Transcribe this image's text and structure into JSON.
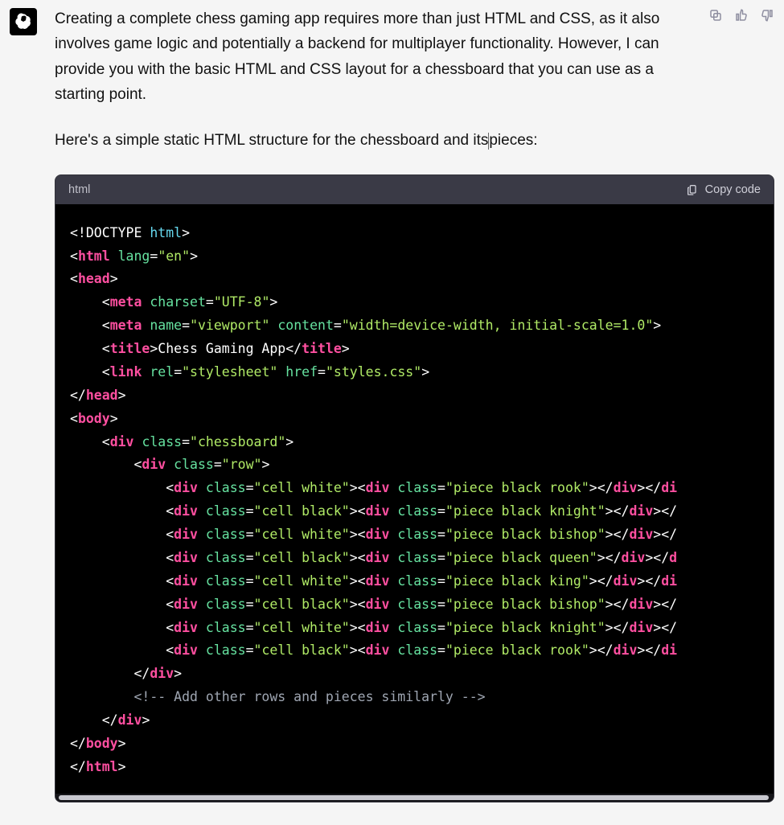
{
  "message": {
    "paragraph1": "Creating a complete chess gaming app requires more than just HTML and CSS, as it also involves game logic and potentially a backend for multiplayer functionality. However, I can provide you with the basic HTML and CSS layout for a chessboard that you can use as a starting point.",
    "paragraph2a": "Here's a simple static HTML structure for the chessboard and its",
    "paragraph2b": "pieces:"
  },
  "code_block": {
    "language": "html",
    "copy_label": "Copy code",
    "lines": [
      {
        "type": "plain",
        "text": "<!DOCTYPE ",
        "after": "html",
        "after_class": "c-keyword",
        "close": ">"
      },
      {
        "type": "tag_open",
        "indent": 0,
        "tag": "html",
        "attrs": [
          {
            "name": "lang",
            "value": "\"en\""
          }
        ]
      },
      {
        "type": "tag_open",
        "indent": 0,
        "tag": "head"
      },
      {
        "type": "tag_open",
        "indent": 1,
        "tag": "meta",
        "attrs": [
          {
            "name": "charset",
            "value": "\"UTF-8\""
          }
        ]
      },
      {
        "type": "tag_open",
        "indent": 1,
        "tag": "meta",
        "attrs": [
          {
            "name": "name",
            "value": "\"viewport\""
          },
          {
            "name": "content",
            "value": "\"width=device-width, initial-scale=1.0\""
          }
        ]
      },
      {
        "type": "tag_with_text",
        "indent": 1,
        "open": "title",
        "text": "Chess Gaming App",
        "close": "title"
      },
      {
        "type": "tag_open",
        "indent": 1,
        "tag": "link",
        "attrs": [
          {
            "name": "rel",
            "value": "\"stylesheet\""
          },
          {
            "name": "href",
            "value": "\"styles.css\""
          }
        ]
      },
      {
        "type": "tag_close",
        "indent": 0,
        "tag": "head"
      },
      {
        "type": "tag_open",
        "indent": 0,
        "tag": "body"
      },
      {
        "type": "tag_open",
        "indent": 1,
        "tag": "div",
        "attrs": [
          {
            "name": "class",
            "value": "\"chessboard\""
          }
        ]
      },
      {
        "type": "tag_open",
        "indent": 2,
        "tag": "div",
        "attrs": [
          {
            "name": "class",
            "value": "\"row\""
          }
        ]
      },
      {
        "type": "cell",
        "indent": 3,
        "cell": "\"cell white\"",
        "piece": "\"piece black rook\"",
        "tail": "</div></di"
      },
      {
        "type": "cell",
        "indent": 3,
        "cell": "\"cell black\"",
        "piece": "\"piece black knight\"",
        "tail": "</div></"
      },
      {
        "type": "cell",
        "indent": 3,
        "cell": "\"cell white\"",
        "piece": "\"piece black bishop\"",
        "tail": "</div></"
      },
      {
        "type": "cell",
        "indent": 3,
        "cell": "\"cell black\"",
        "piece": "\"piece black queen\"",
        "tail": "</div></d"
      },
      {
        "type": "cell",
        "indent": 3,
        "cell": "\"cell white\"",
        "piece": "\"piece black king\"",
        "tail": "</div></di"
      },
      {
        "type": "cell",
        "indent": 3,
        "cell": "\"cell black\"",
        "piece": "\"piece black bishop\"",
        "tail": "</div></"
      },
      {
        "type": "cell",
        "indent": 3,
        "cell": "\"cell white\"",
        "piece": "\"piece black knight\"",
        "tail": "</div></"
      },
      {
        "type": "cell",
        "indent": 3,
        "cell": "\"cell black\"",
        "piece": "\"piece black rook\"",
        "tail": "</div></di"
      },
      {
        "type": "tag_close",
        "indent": 2,
        "tag": "div"
      },
      {
        "type": "comment",
        "indent": 2,
        "text": "<!-- Add other rows and pieces similarly -->"
      },
      {
        "type": "tag_close",
        "indent": 1,
        "tag": "div"
      },
      {
        "type": "tag_close",
        "indent": 0,
        "tag": "body"
      },
      {
        "type": "tag_close",
        "indent": 0,
        "tag": "html"
      }
    ]
  }
}
